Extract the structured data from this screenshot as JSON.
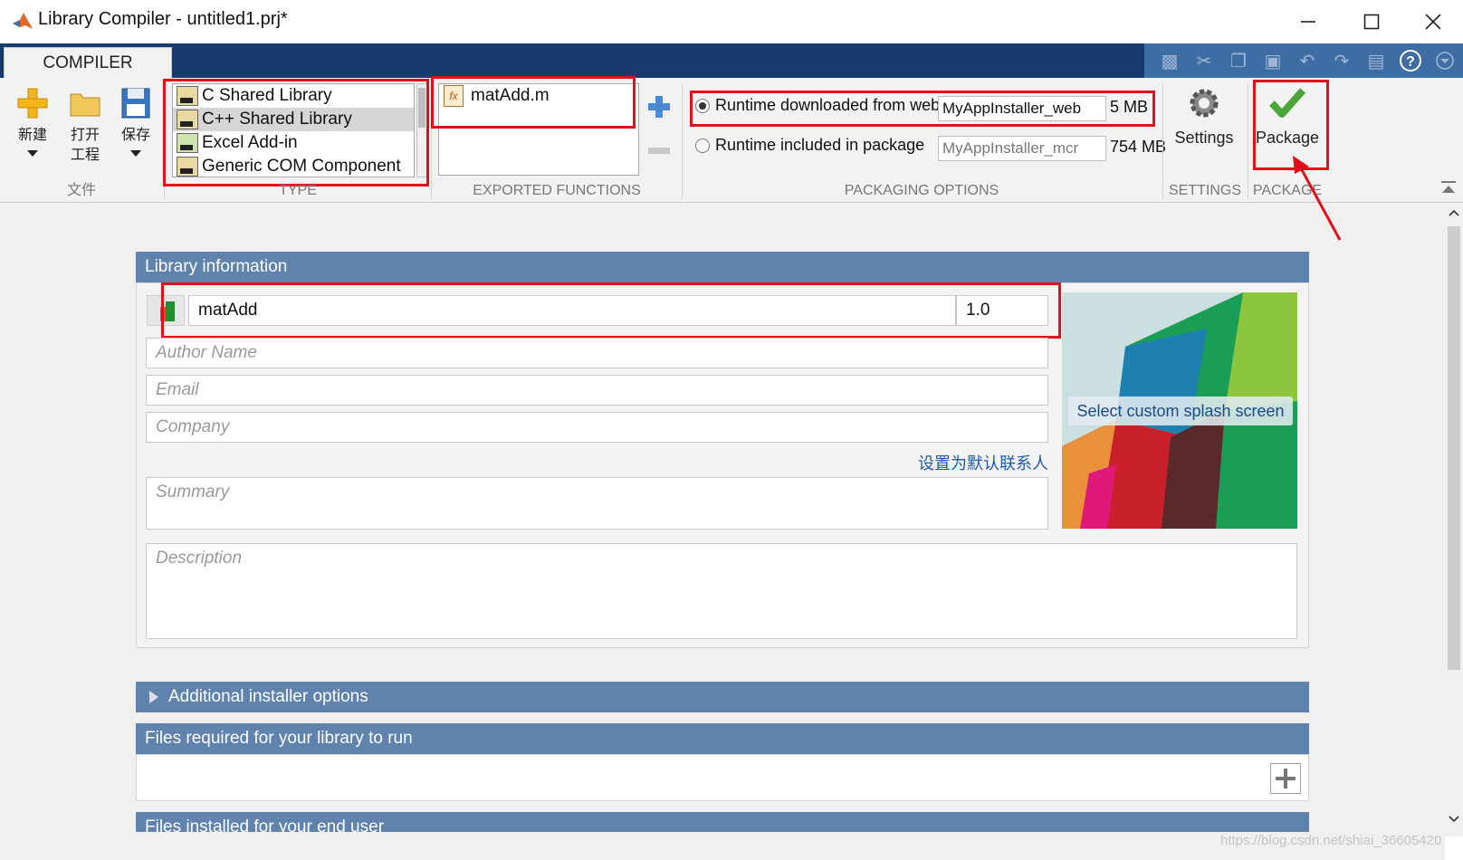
{
  "window": {
    "title": "Library Compiler - untitled1.prj*"
  },
  "toolstrip": {
    "tab": "COMPILER",
    "file_section": {
      "label": "文件",
      "new_label": "新建",
      "open_label_line1": "打开",
      "open_label_line2": "工程",
      "save_label": "保存"
    },
    "type_section": {
      "label": "TYPE",
      "items": [
        {
          "label": "C Shared Library",
          "selected": false
        },
        {
          "label": "C++ Shared Library",
          "selected": true
        },
        {
          "label": "Excel Add-in",
          "selected": false
        },
        {
          "label": "Generic COM Component",
          "selected": false
        }
      ]
    },
    "exported_functions": {
      "label": "EXPORTED FUNCTIONS",
      "items": [
        "matAdd.m"
      ]
    },
    "packaging_options": {
      "label": "PACKAGING OPTIONS",
      "web_label": "Runtime downloaded from web",
      "web_value": "MyAppInstaller_web",
      "web_size": "5 MB",
      "included_label": "Runtime included in package",
      "included_value": "MyAppInstaller_mcr",
      "included_size": "754 MB",
      "selected": "web"
    },
    "settings": {
      "section_label": "SETTINGS",
      "button_label": "Settings"
    },
    "package": {
      "section_label": "PACKAGE",
      "button_label": "Package"
    }
  },
  "library_info": {
    "header": "Library information",
    "name_value": "matAdd",
    "version_value": "1.0",
    "author_placeholder": "Author Name",
    "email_placeholder": "Email",
    "company_placeholder": "Company",
    "set_default_contact_link": "设置为默认联系人",
    "summary_placeholder": "Summary",
    "description_placeholder": "Description",
    "splash_label": "Select custom splash screen"
  },
  "sections": {
    "additional_installer": "Additional installer options",
    "files_required": "Files required for your library to run",
    "files_installed": "Files installed for your end user"
  },
  "watermark": "https://blog.csdn.net/shiai_36605420",
  "colors": {
    "ribbon_header": "#163a6b",
    "section_header": "#5f83ad",
    "annotation_red": "#e0101a",
    "link_blue": "#1c5ba8"
  }
}
